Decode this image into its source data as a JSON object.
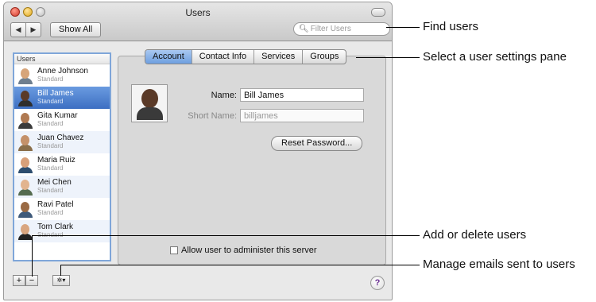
{
  "window": {
    "title": "Users",
    "show_all_label": "Show All",
    "back_glyph": "◀",
    "forward_glyph": "▶",
    "search_placeholder": "Filter Users"
  },
  "user_list": {
    "header": "Users",
    "users": [
      {
        "name": "Anne Johnson",
        "role": "Standard",
        "skin": "#d7a57a",
        "shirt": "#6f7f8f"
      },
      {
        "name": "Bill James",
        "role": "Standard",
        "skin": "#5a3a28",
        "shirt": "#2e2e2e"
      },
      {
        "name": "Gita Kumar",
        "role": "Standard",
        "skin": "#b07a52",
        "shirt": "#3b3b3b"
      },
      {
        "name": "Juan Chavez",
        "role": "Standard",
        "skin": "#c4916a",
        "shirt": "#8a6e4a"
      },
      {
        "name": "Maria Ruiz",
        "role": "Standard",
        "skin": "#d8a07a",
        "shirt": "#2d4d6e"
      },
      {
        "name": "Mei Chen",
        "role": "Standard",
        "skin": "#e2b48f",
        "shirt": "#556b4f"
      },
      {
        "name": "Ravi Patel",
        "role": "Standard",
        "skin": "#9a6a44",
        "shirt": "#3f5a7a"
      },
      {
        "name": "Tom Clark",
        "role": "Standard",
        "skin": "#d9a680",
        "shirt": "#222222"
      }
    ],
    "selected_index": 1,
    "add_label": "+",
    "remove_label": "−",
    "gear_label": "✲▾"
  },
  "tabs": [
    "Account",
    "Contact Info",
    "Services",
    "Groups"
  ],
  "active_tab": 0,
  "account": {
    "name_label": "Name:",
    "name_value": "Bill James",
    "short_name_label": "Short Name:",
    "short_name_value": "billjames",
    "reset_password_label": "Reset Password...",
    "admin_label": "Allow user to administer this server",
    "admin_checked": false
  },
  "help_label": "?",
  "callouts": {
    "find_users": "Find users",
    "select_pane": "Select a user settings pane",
    "add_delete": "Add or delete users",
    "manage_emails": "Manage emails sent to users"
  },
  "colors": {
    "selection": "#3d6fc2",
    "active_tab": "#6e9fe0",
    "list_border": "#7fa6d9"
  }
}
